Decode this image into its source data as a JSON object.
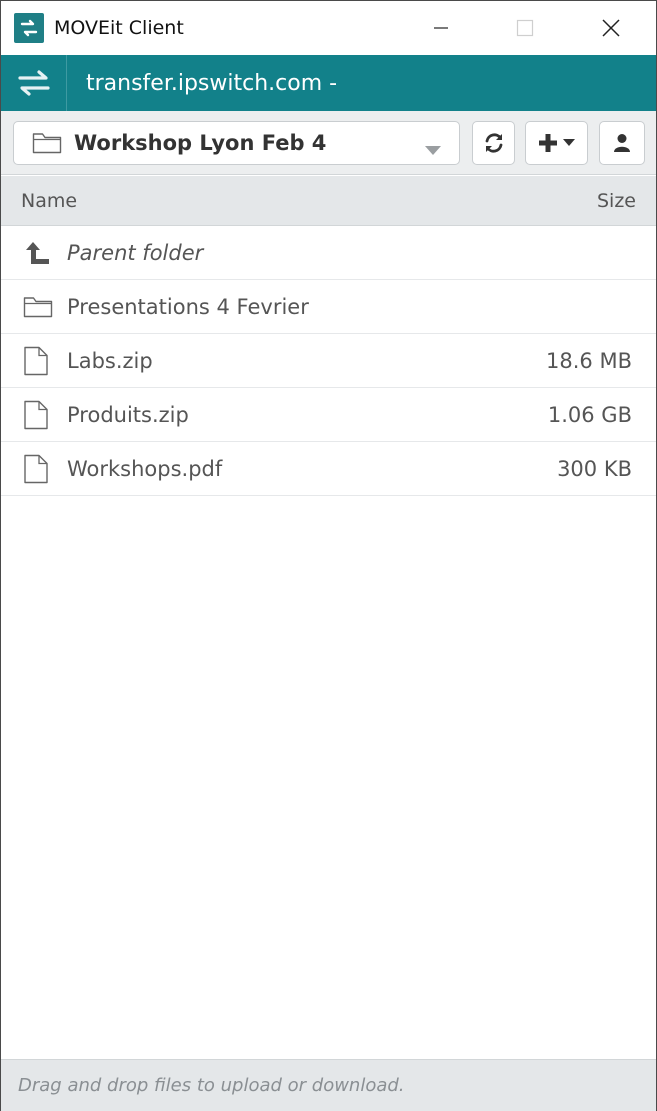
{
  "window": {
    "title": "MOVEit Client",
    "app_icon": "moveit-logo-icon",
    "controls": [
      "minimize-icon",
      "maximize-icon",
      "close-icon"
    ]
  },
  "header": {
    "swap_icon": "swap-arrows-icon",
    "host": "transfer.ipswitch.com -",
    "background": "#12818a"
  },
  "toolbar": {
    "folder_select": {
      "icon": "folder-icon",
      "value": "Workshop Lyon Feb 4",
      "caret": "caret-down-icon"
    },
    "buttons": [
      {
        "name": "refresh-button",
        "icon": "refresh-icon"
      },
      {
        "name": "add-menu-button",
        "icon": "plus-icon"
      },
      {
        "name": "account-button",
        "icon": "user-icon"
      }
    ]
  },
  "columns": {
    "name": "Name",
    "size": "Size"
  },
  "rows": [
    {
      "icon": "parent-folder-icon",
      "name": "Parent folder",
      "size": ""
    },
    {
      "icon": "folder-icon",
      "name": "Presentations 4 Fevrier",
      "size": ""
    },
    {
      "icon": "file-icon",
      "name": "Labs.zip",
      "size": "18.6 MB"
    },
    {
      "icon": "file-icon",
      "name": "Produits.zip",
      "size": "1.06 GB"
    },
    {
      "icon": "file-icon",
      "name": "Workshops.pdf",
      "size": "300 KB"
    }
  ],
  "footer": {
    "hint": "Drag and drop files to upload or download."
  }
}
